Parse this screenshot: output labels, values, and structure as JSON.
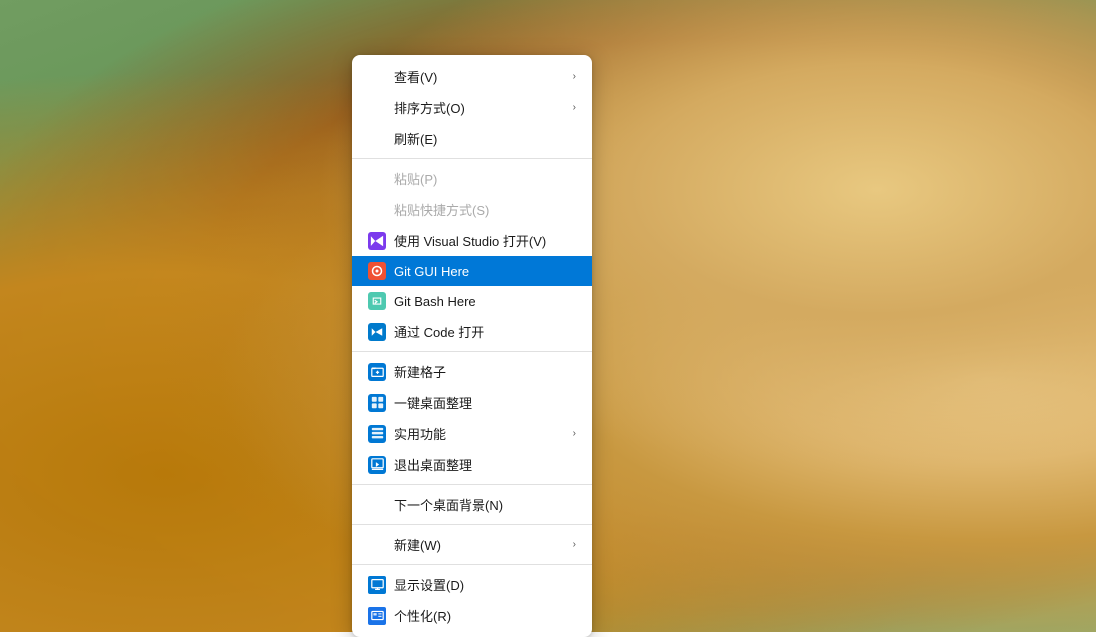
{
  "desktop": {
    "bg_color": "#7aaa6a"
  },
  "context_menu": {
    "items": [
      {
        "id": "view",
        "label": "查看(V)",
        "has_arrow": true,
        "has_icon": false,
        "disabled": false,
        "highlighted": false
      },
      {
        "id": "sort",
        "label": "排序方式(O)",
        "has_arrow": true,
        "has_icon": false,
        "disabled": false,
        "highlighted": false
      },
      {
        "id": "refresh",
        "label": "刷新(E)",
        "has_arrow": false,
        "has_icon": false,
        "disabled": false,
        "highlighted": false
      },
      {
        "id": "sep1",
        "type": "separator"
      },
      {
        "id": "paste",
        "label": "粘贴(P)",
        "has_arrow": false,
        "has_icon": false,
        "disabled": true,
        "highlighted": false
      },
      {
        "id": "paste-shortcut",
        "label": "粘贴快捷方式(S)",
        "has_arrow": false,
        "has_icon": false,
        "disabled": true,
        "highlighted": false
      },
      {
        "id": "open-vs",
        "label": "使用 Visual Studio 打开(V)",
        "has_arrow": false,
        "has_icon": true,
        "icon_type": "vs",
        "disabled": false,
        "highlighted": false
      },
      {
        "id": "git-gui",
        "label": "Git GUI Here",
        "has_arrow": false,
        "has_icon": true,
        "icon_type": "git-gui",
        "disabled": false,
        "highlighted": true
      },
      {
        "id": "git-bash",
        "label": "Git Bash Here",
        "has_arrow": false,
        "has_icon": true,
        "icon_type": "git-bash",
        "disabled": false,
        "highlighted": false
      },
      {
        "id": "open-code",
        "label": "通过 Code 打开",
        "has_arrow": false,
        "has_icon": true,
        "icon_type": "vscode",
        "disabled": false,
        "highlighted": false
      },
      {
        "id": "sep2",
        "type": "separator"
      },
      {
        "id": "new-folder",
        "label": "新建格子",
        "has_arrow": false,
        "has_icon": true,
        "icon_type": "new-folder",
        "disabled": false,
        "highlighted": false
      },
      {
        "id": "desktop-org",
        "label": "一键桌面整理",
        "has_arrow": false,
        "has_icon": true,
        "icon_type": "desktop-org",
        "disabled": false,
        "highlighted": false
      },
      {
        "id": "practical",
        "label": "实用功能",
        "has_arrow": true,
        "has_icon": true,
        "icon_type": "practical",
        "disabled": false,
        "highlighted": false
      },
      {
        "id": "exit-desktop",
        "label": "退出桌面整理",
        "has_arrow": false,
        "has_icon": true,
        "icon_type": "exit-desktop",
        "disabled": false,
        "highlighted": false
      },
      {
        "id": "sep3",
        "type": "separator"
      },
      {
        "id": "next-wallpaper",
        "label": "下一个桌面背景(N)",
        "has_arrow": false,
        "has_icon": false,
        "disabled": false,
        "highlighted": false
      },
      {
        "id": "sep4",
        "type": "separator"
      },
      {
        "id": "new",
        "label": "新建(W)",
        "has_arrow": true,
        "has_icon": false,
        "disabled": false,
        "highlighted": false
      },
      {
        "id": "sep5",
        "type": "separator"
      },
      {
        "id": "display-settings",
        "label": "显示设置(D)",
        "has_arrow": false,
        "has_icon": true,
        "icon_type": "display",
        "disabled": false,
        "highlighted": false
      },
      {
        "id": "personalize",
        "label": "个性化(R)",
        "has_arrow": false,
        "has_icon": true,
        "icon_type": "personalize",
        "disabled": false,
        "highlighted": false
      }
    ],
    "icons": {
      "vs": "M",
      "git-gui": "●",
      "git-bash": "◆",
      "vscode": "◈",
      "new-folder": "+",
      "desktop-org": "▦",
      "practical": "▤",
      "exit-desktop": "◧",
      "display": "▣",
      "personalize": "✉"
    }
  }
}
